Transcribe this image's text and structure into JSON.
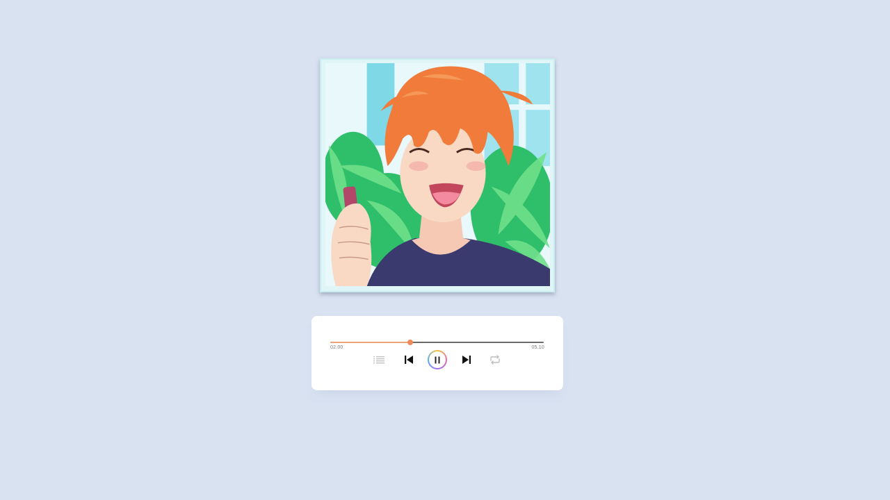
{
  "album": {
    "cover": "anime-boy-smiling-with-phone"
  },
  "player": {
    "current_time": "02.00",
    "duration": "05.10",
    "progress_fraction": 0.375,
    "state": "playing",
    "controls": {
      "playlist_icon": "list-icon",
      "previous_icon": "skip-previous-icon",
      "play_pause_icon": "pause-icon",
      "next_icon": "skip-next-icon",
      "repeat_icon": "repeat-icon"
    }
  },
  "colors": {
    "background": "#d8e2f1",
    "progress_fill": "#f0a27a",
    "progress_knob": "#ee8a5a",
    "track": "#6b6b6b"
  }
}
